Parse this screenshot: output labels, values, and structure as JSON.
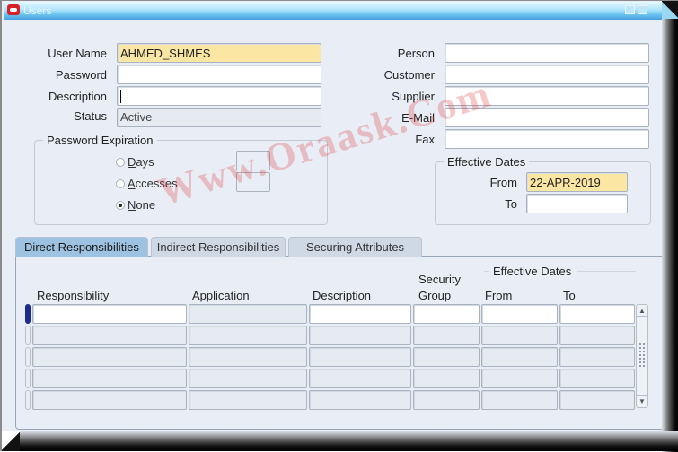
{
  "window": {
    "title": "Users",
    "icon": "oracle-app-icon",
    "controls": [
      "minimize-icon",
      "maximize-icon"
    ]
  },
  "form": {
    "user_name": {
      "label": "User Name",
      "value": "AHMED_SHMES"
    },
    "password": {
      "label": "Password",
      "value": ""
    },
    "description": {
      "label": "Description",
      "value": ""
    },
    "status": {
      "label": "Status",
      "value": "Active"
    },
    "person": {
      "label": "Person",
      "value": ""
    },
    "customer": {
      "label": "Customer",
      "value": ""
    },
    "supplier": {
      "label": "Supplier",
      "value": ""
    },
    "email": {
      "label": "E-Mail",
      "value": ""
    },
    "fax": {
      "label": "Fax",
      "value": ""
    }
  },
  "password_expiration": {
    "title": "Password Expiration",
    "options": [
      {
        "mnemonic": "D",
        "rest": "ays",
        "label": "Days",
        "selected": false,
        "value": ""
      },
      {
        "mnemonic": "A",
        "rest": "ccesses",
        "label": "Accesses",
        "selected": false,
        "value": ""
      },
      {
        "mnemonic": "N",
        "rest": "one",
        "label": "None",
        "selected": true
      }
    ]
  },
  "effective_dates": {
    "title": "Effective Dates",
    "from": {
      "label": "From",
      "value": "22-APR-2019"
    },
    "to": {
      "label": "To",
      "value": ""
    }
  },
  "watermark": "Www.Oraask.Com",
  "tabs": [
    {
      "label": "Direct Responsibilities",
      "active": true
    },
    {
      "label": "Indirect Responsibilities",
      "active": false
    },
    {
      "label": "Securing Attributes",
      "active": false
    }
  ],
  "grid": {
    "columns": {
      "responsibility": "Responsibility",
      "application": "Application",
      "description": "Description",
      "security_group_1": "Security",
      "security_group_2": "Group",
      "effective_dates": "Effective Dates",
      "from": "From",
      "to": "To"
    },
    "rows": [
      {
        "responsibility": "",
        "application": "",
        "description": "",
        "security_group": "",
        "from": "",
        "to": "",
        "current": true
      },
      {
        "responsibility": "",
        "application": "",
        "description": "",
        "security_group": "",
        "from": "",
        "to": "",
        "current": false
      },
      {
        "responsibility": "",
        "application": "",
        "description": "",
        "security_group": "",
        "from": "",
        "to": "",
        "current": false
      },
      {
        "responsibility": "",
        "application": "",
        "description": "",
        "security_group": "",
        "from": "",
        "to": "",
        "current": false
      },
      {
        "responsibility": "",
        "application": "",
        "description": "",
        "security_group": "",
        "from": "",
        "to": "",
        "current": false
      }
    ]
  },
  "colors": {
    "required_field": "#fbe6a4",
    "active_tab": "#9ec2e2",
    "record_indicator": "#1d2c8a",
    "background": "#e9eef6"
  }
}
